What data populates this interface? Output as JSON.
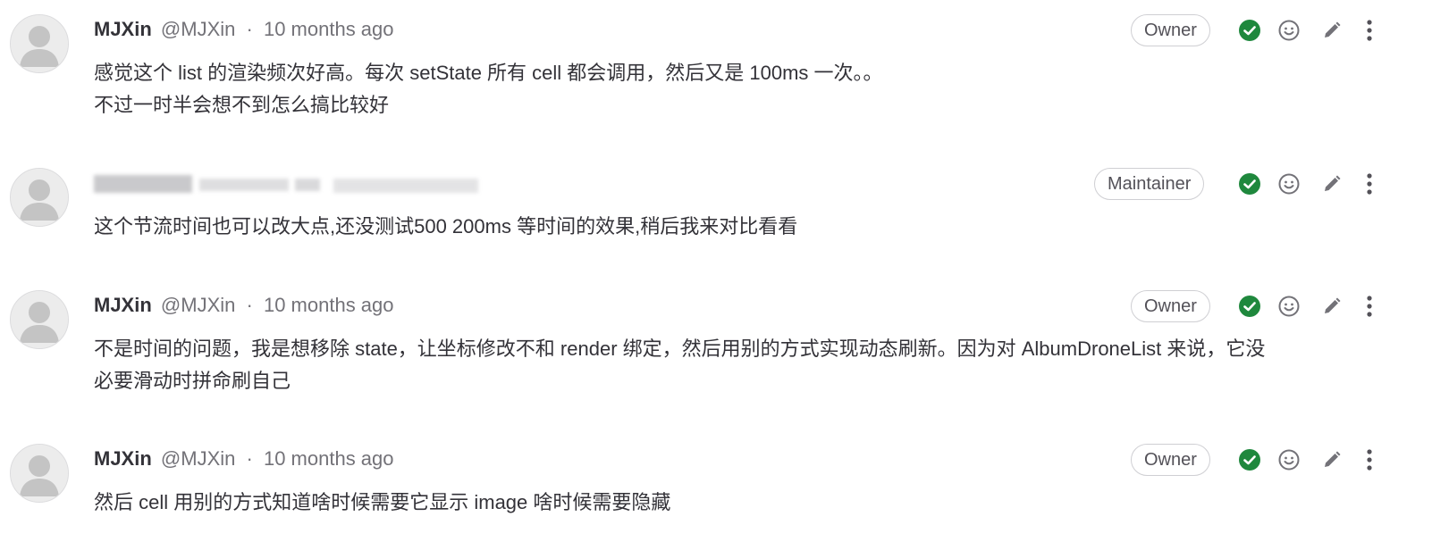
{
  "colors": {
    "resolved_green": "#1f883d",
    "icon_gray": "#737278",
    "text": "#333238",
    "muted": "#737278",
    "badge_border": "#cfcfd3"
  },
  "icons": {
    "resolve": "check-circle-icon",
    "emoji": "smiley-icon",
    "edit": "pencil-icon",
    "more": "ellipsis-v-icon",
    "avatar": "default-avatar-icon"
  },
  "notes": [
    {
      "author_name": "MJXin",
      "author_handle": "@MJXin",
      "separator": "·",
      "time": "10 months ago",
      "role": "Owner",
      "lines": [
        "感觉这个 list 的渲染频次好高。每次 setState 所有 cell 都会调用，然后又是 100ms 一次。。",
        "不过一时半会想不到怎么搞比较好"
      ]
    },
    {
      "author_name": "",
      "author_handle": "",
      "separator": "·",
      "time": "",
      "role": "Maintainer",
      "lines": [
        "这个节流时间也可以改大点,还没测试500 200ms 等时间的效果,稍后我来对比看看"
      ]
    },
    {
      "author_name": "MJXin",
      "author_handle": "@MJXin",
      "separator": "·",
      "time": "10 months ago",
      "role": "Owner",
      "lines": [
        "不是时间的问题，我是想移除 state，让坐标修改不和 render 绑定，然后用别的方式实现动态刷新。因为对 AlbumDroneList 来说，它没",
        "必要滑动时拼命刷自己"
      ]
    },
    {
      "author_name": "MJXin",
      "author_handle": "@MJXin",
      "separator": "·",
      "time": "10 months ago",
      "role": "Owner",
      "lines": [
        "然后 cell 用别的方式知道啥时候需要它显示 image 啥时候需要隐藏"
      ]
    }
  ]
}
